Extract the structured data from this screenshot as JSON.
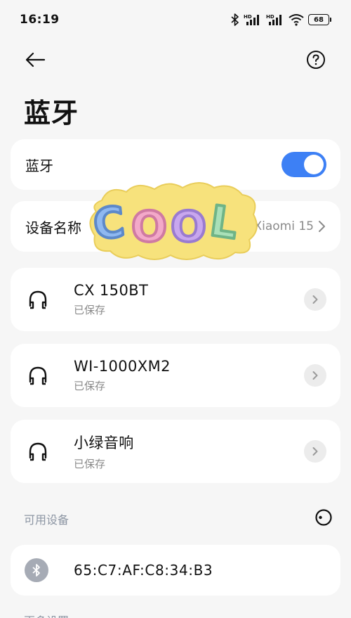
{
  "status": {
    "time": "16:19",
    "battery": "68"
  },
  "page": {
    "title": "蓝牙"
  },
  "bluetooth_row": {
    "label": "蓝牙",
    "enabled": true
  },
  "device_name_row": {
    "label": "设备名称",
    "value": "1Xiaomi 15"
  },
  "saved_devices": [
    {
      "name": "CX 150BT",
      "status": "已保存"
    },
    {
      "name": "WI-1000XM2",
      "status": "已保存"
    },
    {
      "name": "小绿音响",
      "status": "已保存"
    }
  ],
  "available": {
    "section_label": "可用设备",
    "devices": [
      {
        "name": "65:C7:AF:C8:34:B3"
      }
    ]
  },
  "more_section_label": "更多设置",
  "sticker_text": "COOL",
  "colors": {
    "accent": "#3d80f5",
    "card": "#ffffff",
    "background": "#f6f6f6"
  }
}
